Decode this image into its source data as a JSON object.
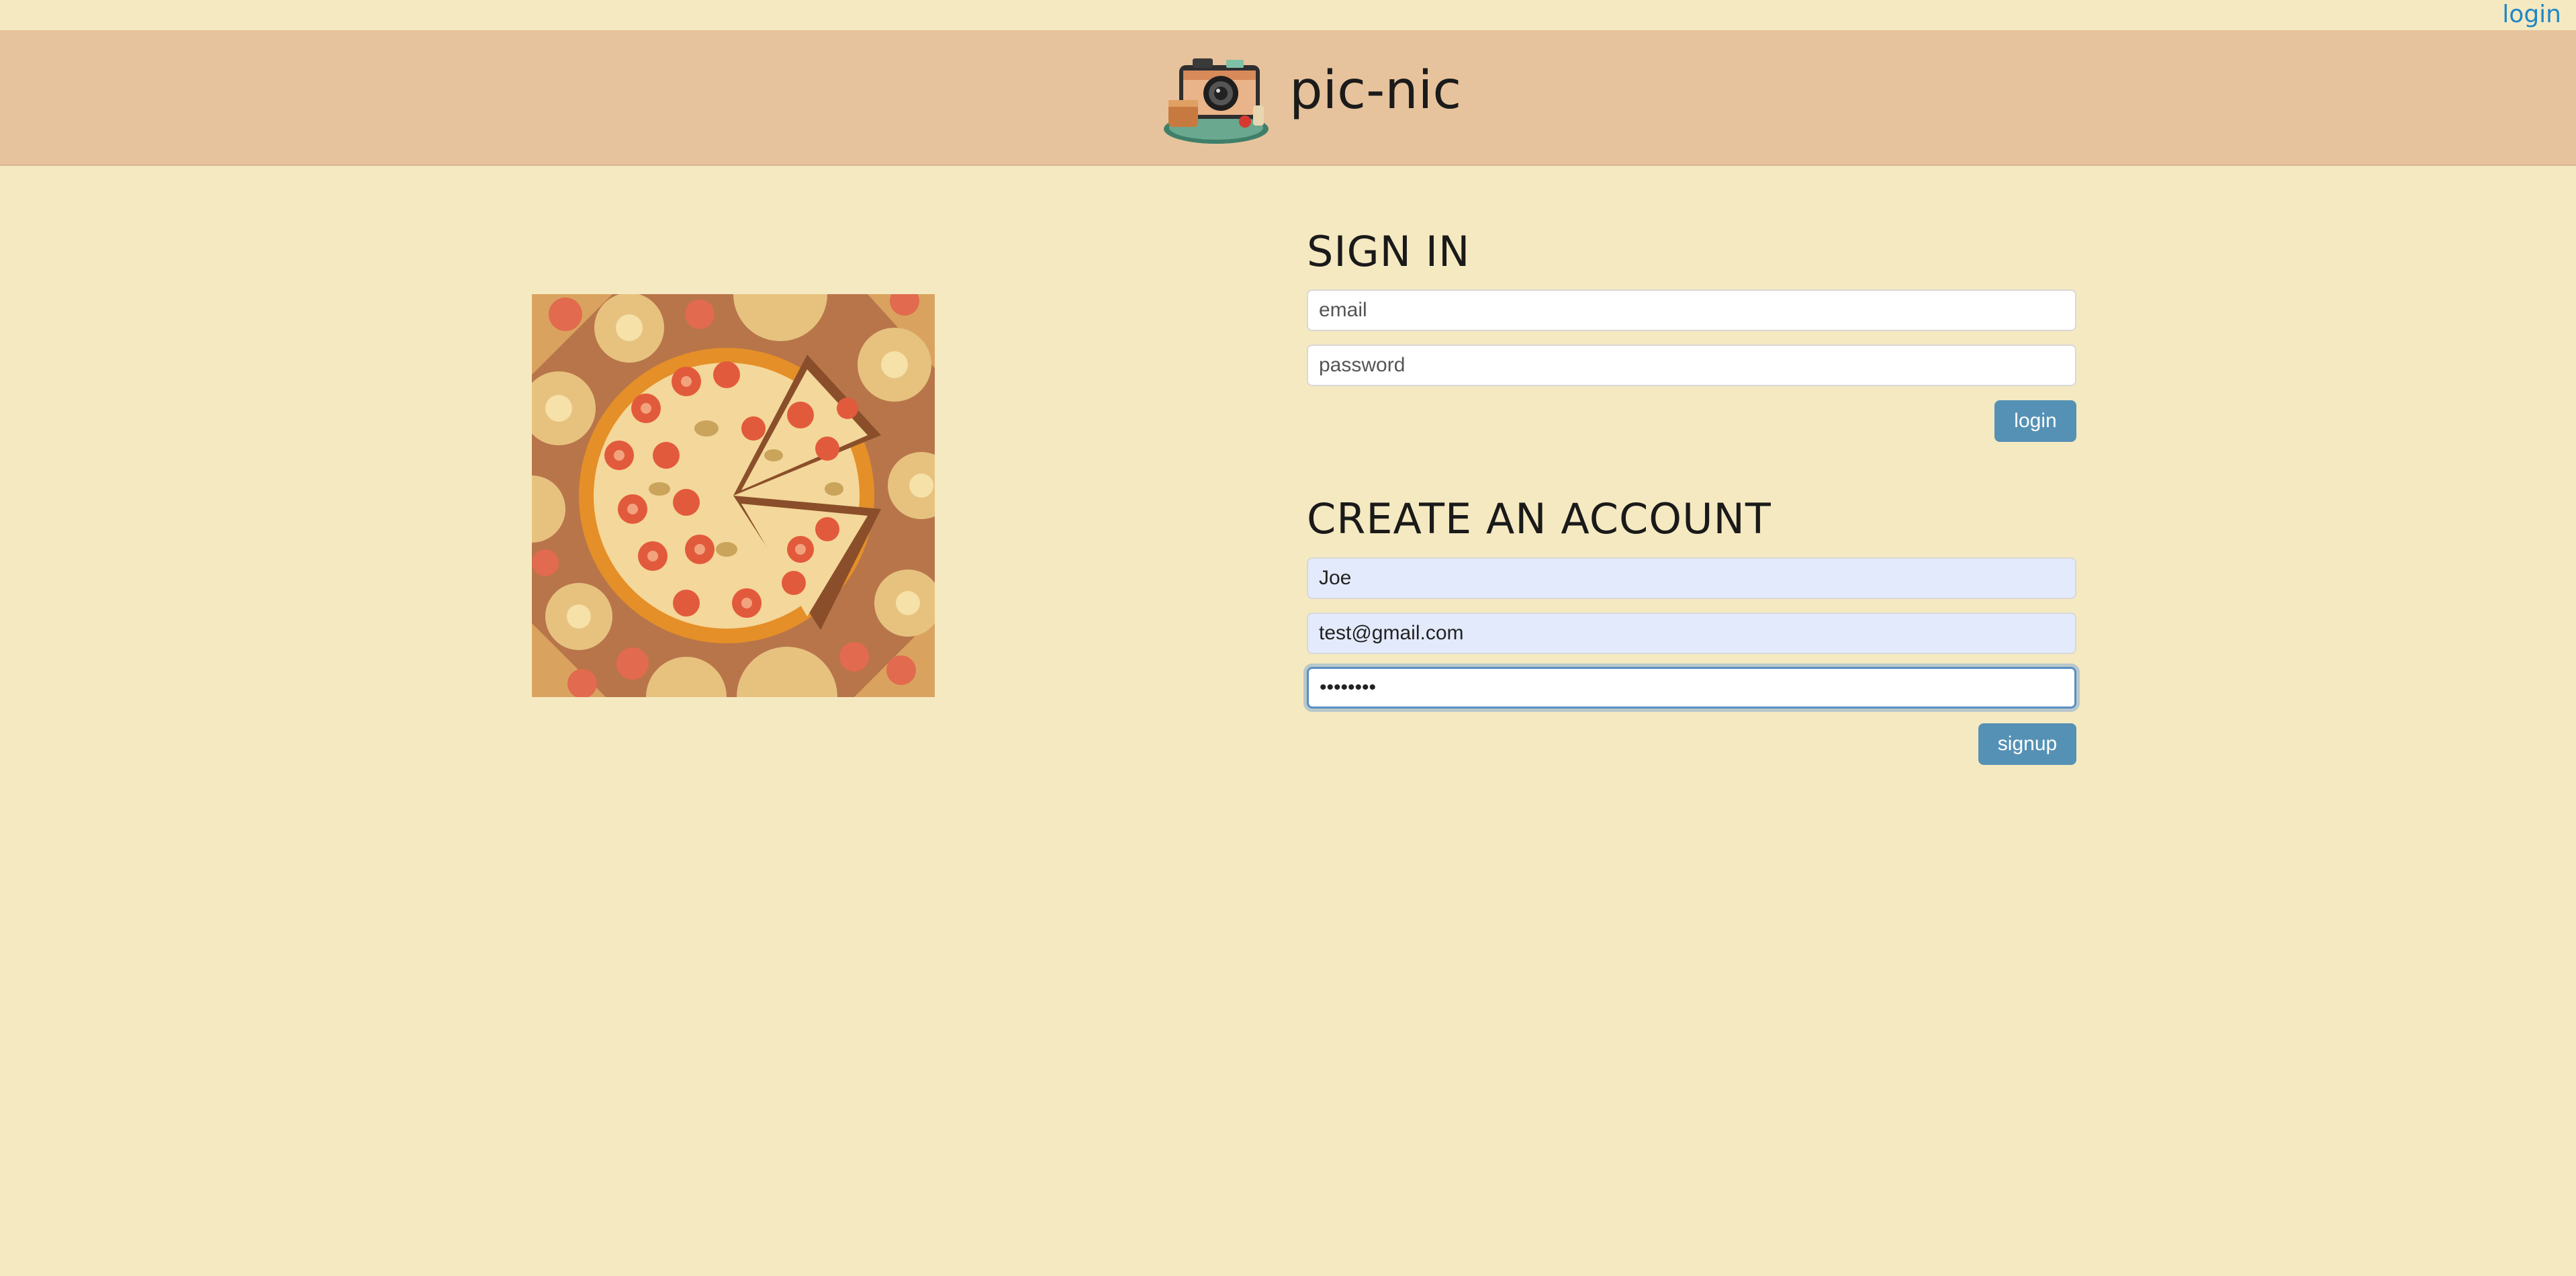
{
  "topbar": {
    "login_label": "login"
  },
  "header": {
    "brand": "pic-nic",
    "logo_icon": "camera-picnic-basket-icon"
  },
  "hero": {
    "image_icon": "pizza-illustration"
  },
  "signin": {
    "title": "SIGN IN",
    "email_placeholder": "email",
    "password_placeholder": "password",
    "button_label": "login"
  },
  "signup": {
    "title": "CREATE AN ACCOUNT",
    "name_value": "Joe",
    "email_value": "test@gmail.com",
    "password_value": "••••••••",
    "button_label": "signup"
  },
  "colors": {
    "background": "#f5e9c1",
    "header": "#e6c39c",
    "button": "#5591b5",
    "link": "#1f86c7"
  }
}
